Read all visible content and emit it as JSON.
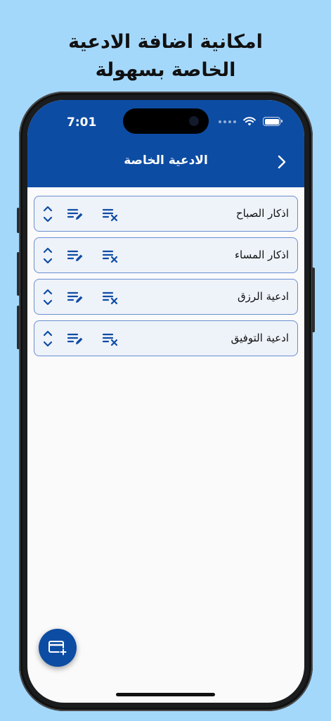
{
  "promo": {
    "line1": "امكانية اضافة الادعية",
    "line2": "الخاصة بسهولة"
  },
  "status_bar": {
    "time": "7:01"
  },
  "nav": {
    "title": "الادعية الخاصة"
  },
  "duas": [
    {
      "title": "اذكار الصباح"
    },
    {
      "title": "اذكار المساء"
    },
    {
      "title": "ادعية الرزق"
    },
    {
      "title": "ادعية التوفيق"
    }
  ],
  "colors": {
    "background": "#a4d8fb",
    "header": "#0d4ca3",
    "card_bg": "#eef2f9",
    "card_border": "#6a8fd0",
    "icon": "#0d4ca3"
  },
  "icons": {
    "reorder": "reorder-icon",
    "edit": "edit-list-icon",
    "remove": "remove-list-icon",
    "back": "chevron-right-icon",
    "add": "add-card-icon"
  }
}
